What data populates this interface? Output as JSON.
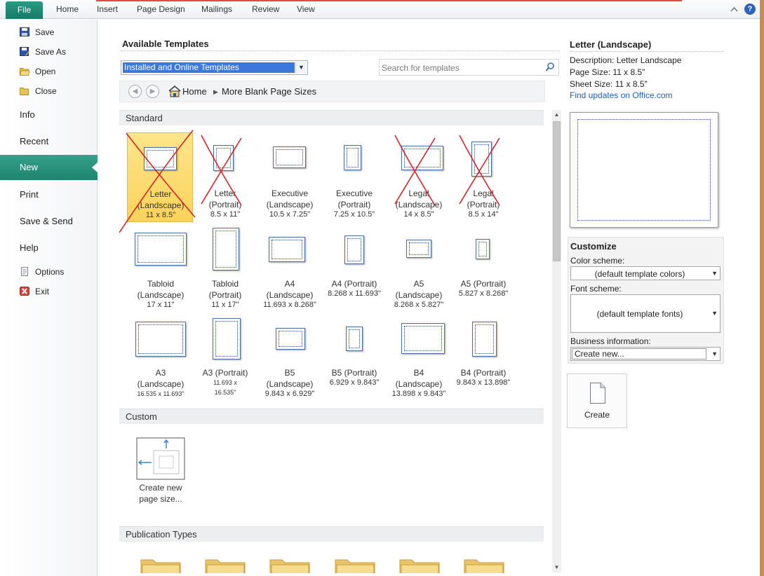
{
  "ribbon": {
    "file_tab": "File",
    "tabs": [
      "Home",
      "Insert",
      "Page Design",
      "Mailings",
      "Review",
      "View"
    ],
    "help_label": "?"
  },
  "backstage": {
    "commands": [
      {
        "label": "Save",
        "icon": "save-icon"
      },
      {
        "label": "Save As",
        "icon": "save-as-icon"
      },
      {
        "label": "Open",
        "icon": "open-folder-icon"
      },
      {
        "label": "Close",
        "icon": "close-folder-icon"
      }
    ],
    "tabs": [
      "Info",
      "Recent",
      "New",
      "Print",
      "Save & Send",
      "Help"
    ],
    "active_tab": "New",
    "bottom_commands": [
      {
        "label": "Options",
        "icon": "options-icon"
      },
      {
        "label": "Exit",
        "icon": "exit-icon"
      }
    ]
  },
  "main": {
    "title": "Available Templates",
    "source_select": "Installed and Online Templates",
    "search_placeholder": "Search for templates",
    "breadcrumb": {
      "home": "Home",
      "current": "More Blank Page Sizes"
    },
    "groups": {
      "standard": "Standard",
      "custom": "Custom",
      "publication_types": "Publication Types"
    },
    "templates": [
      {
        "name": "Letter\n(Landscape)",
        "dims": "11 x 8.5\"",
        "selected": true,
        "crossed_out": true
      },
      {
        "name": "Letter\n(Portrait)",
        "dims": "8.5 x 11\"",
        "selected": false,
        "crossed_out": true
      },
      {
        "name": "Executive\n(Landscape)",
        "dims": "10.5 x 7.25\"",
        "selected": false,
        "crossed_out": false
      },
      {
        "name": "Executive\n(Portrait)",
        "dims": "7.25 x 10.5\"",
        "selected": false,
        "crossed_out": false
      },
      {
        "name": "Legal\n(Landscape)",
        "dims": "14 x 8.5\"",
        "selected": false,
        "crossed_out": true
      },
      {
        "name": "Legal\n(Portrait)",
        "dims": "8.5 x 14\"",
        "selected": false,
        "crossed_out": true
      },
      {
        "name": "Tabloid\n(Landscape)",
        "dims": "17 x 11\"",
        "selected": false,
        "crossed_out": false
      },
      {
        "name": "Tabloid\n(Portrait)",
        "dims": "11 x 17\"",
        "selected": false,
        "crossed_out": false
      },
      {
        "name": "A4\n(Landscape)",
        "dims": "11.693 x 8.268\"",
        "selected": false,
        "crossed_out": false
      },
      {
        "name": "A4 (Portrait)",
        "dims": "8.268 x 11.693\"",
        "selected": false,
        "crossed_out": false
      },
      {
        "name": "A5\n(Landscape)",
        "dims": "8.268 x 5.827\"",
        "selected": false,
        "crossed_out": false
      },
      {
        "name": "A5 (Portrait)",
        "dims": "5.827 x 8.268\"",
        "selected": false,
        "crossed_out": false
      },
      {
        "name": "A3\n(Landscape)",
        "dims": "16.535 x 11.693\"",
        "selected": false,
        "crossed_out": false
      },
      {
        "name": "A3 (Portrait)",
        "dims": "11.693 x\n16.535\"",
        "selected": false,
        "crossed_out": false
      },
      {
        "name": "B5\n(Landscape)",
        "dims": "9.843 x 6.929\"",
        "selected": false,
        "crossed_out": false
      },
      {
        "name": "B5 (Portrait)",
        "dims": "6.929 x 9.843\"",
        "selected": false,
        "crossed_out": false
      },
      {
        "name": "B4\n(Landscape)",
        "dims": "13.898 x 9.843\"",
        "selected": false,
        "crossed_out": false
      },
      {
        "name": "B4 (Portrait)",
        "dims": "9.843 x 13.898\"",
        "selected": false,
        "crossed_out": false
      }
    ],
    "custom_tile": "Create new\npage size..."
  },
  "details": {
    "title": "Letter (Landscape)",
    "description": "Description: Letter Landscape",
    "page_size": "Page Size: 11 x 8.5\"",
    "sheet_size": "Sheet Size: 11 x 8.5\"",
    "updates_link": "Find updates on Office.com",
    "customize": {
      "heading": "Customize",
      "color_scheme_label": "Color scheme:",
      "color_scheme_value": "(default template colors)",
      "font_scheme_label": "Font scheme:",
      "font_scheme_value": "(default template fonts)",
      "business_info_label": "Business information:",
      "business_info_value": "Create new..."
    },
    "create_label": "Create"
  },
  "colors": {
    "accent_teal": "#1f8470",
    "selection_yellow": "#fbd35a",
    "annotation_red": "#d8232a",
    "link_blue": "#1a5ebd"
  }
}
